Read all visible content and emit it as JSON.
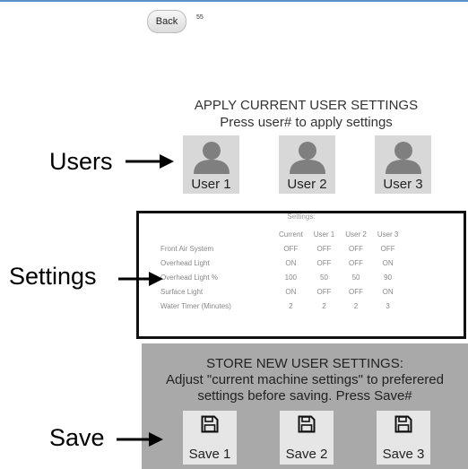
{
  "header": {
    "back_label": "Back",
    "page_number": "55"
  },
  "apply": {
    "title": "APPLY CURRENT USER SETTINGS",
    "subtitle": "Press user# to apply settings",
    "users": [
      {
        "label": "User 1",
        "icon": "user-avatar-icon"
      },
      {
        "label": "User 2",
        "icon": "user-avatar-icon"
      },
      {
        "label": "User 3",
        "icon": "user-avatar-icon"
      }
    ]
  },
  "settings": {
    "heading": "Settings:",
    "columns": [
      "",
      "Current",
      "User 1",
      "User 2",
      "User 3"
    ],
    "rows": [
      {
        "name": "Front Air System",
        "values": [
          "OFF",
          "OFF",
          "OFF",
          "OFF"
        ]
      },
      {
        "name": "Overhead Light",
        "values": [
          "ON",
          "OFF",
          "OFF",
          "ON"
        ]
      },
      {
        "name": "Overhead Light %",
        "values": [
          "100",
          "50",
          "50",
          "90"
        ]
      },
      {
        "name": "Surface Light",
        "values": [
          "ON",
          "OFF",
          "OFF",
          "ON"
        ]
      },
      {
        "name": "Water Timer (Minutes)",
        "values": [
          "2",
          "2",
          "2",
          "3"
        ]
      }
    ]
  },
  "store": {
    "line1": "STORE NEW USER SETTINGS:",
    "line2": "Adjust \"current machine settings\"  to preferered",
    "line3": "settings before saving.  Press Save#",
    "saves": [
      {
        "label": "Save 1",
        "icon": "floppy-disk-icon"
      },
      {
        "label": "Save 2",
        "icon": "floppy-disk-icon"
      },
      {
        "label": "Save 3",
        "icon": "floppy-disk-icon"
      }
    ]
  },
  "annotations": {
    "users": "Users",
    "settings": "Settings",
    "save": "Save"
  },
  "colors": {
    "top_rule": "#5b8fc8",
    "user_button": "#d8d8d8",
    "store_panel": "#a9a9a9",
    "save_button": "#e6e6e6",
    "icon_gray": "#7f7f7f"
  }
}
